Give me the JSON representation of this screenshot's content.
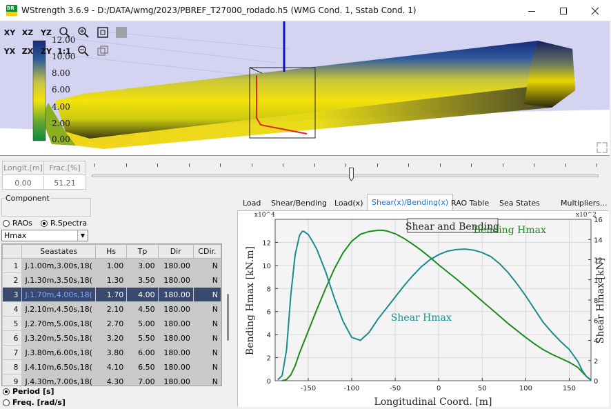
{
  "window": {
    "title": "WStrength 3.6.9 - D:/DATA/wmg/2023/PBREF_T27000_rodado.h5 (WMG Cond. 1, Sstab Cond. 1)",
    "logo_text": "BR",
    "logo_icon": "petrobras-logo-icon",
    "minimize_icon": "minimize-icon",
    "maximize_icon": "maximize-icon",
    "close_icon": "close-icon"
  },
  "view_toolbar": {
    "row1": [
      "XY",
      "XZ",
      "YZ"
    ],
    "row2": [
      "YX",
      "ZX",
      "ZY",
      "1:1"
    ],
    "icons": [
      "zoom-icon",
      "zoom-in-icon",
      "fit-view-icon",
      "color-square-icon",
      "zoom-out-icon",
      "perspective-icon"
    ]
  },
  "colorbar": {
    "labels": [
      "12.00",
      "10.00",
      "8.00",
      "6.00",
      "4.00",
      "2.00",
      "0.00"
    ],
    "colors_top_to_bottom": [
      "#1a2a7a",
      "#2a5a9a",
      "#c8c640",
      "#f5e20a",
      "#6aaa30",
      "#0a8a3a"
    ]
  },
  "position": {
    "headers": [
      "Longit.[m]",
      "Frac.[%]"
    ],
    "values": [
      "0.00",
      "51.21"
    ],
    "slider_fraction": 0.5121
  },
  "component": {
    "group_title": "Component",
    "radio_raos": "RAOs",
    "radio_spectra": "R.Spectra",
    "selected": "R.Spectra",
    "dropdown_value": "Hmax"
  },
  "seastates": {
    "headers": [
      "",
      "Seastates",
      "Hs",
      "Tp",
      "Dir",
      "CDir."
    ],
    "selected_row": 3,
    "rows": [
      {
        "n": "1",
        "name": "J.1.00m,3.00s,18(",
        "hs": "1.00",
        "tp": "3.00",
        "dir": "180.00",
        "cdir": "N"
      },
      {
        "n": "2",
        "name": "J.1.30m,3.50s,18(",
        "hs": "1.30",
        "tp": "3.50",
        "dir": "180.00",
        "cdir": "N"
      },
      {
        "n": "3",
        "name": "J.1.70m,4.00s,18(",
        "hs": "1.70",
        "tp": "4.00",
        "dir": "180.00",
        "cdir": "N"
      },
      {
        "n": "4",
        "name": "J.2.10m,4.50s,18(",
        "hs": "2.10",
        "tp": "4.50",
        "dir": "180.00",
        "cdir": "N"
      },
      {
        "n": "5",
        "name": "J.2.70m,5.00s,18(",
        "hs": "2.70",
        "tp": "5.00",
        "dir": "180.00",
        "cdir": "N"
      },
      {
        "n": "6",
        "name": "J.3.20m,5.50s,18(",
        "hs": "3.20",
        "tp": "5.50",
        "dir": "180.00",
        "cdir": "N"
      },
      {
        "n": "7",
        "name": "J.3.80m,6.00s,18(",
        "hs": "3.80",
        "tp": "6.00",
        "dir": "180.00",
        "cdir": "N"
      },
      {
        "n": "8",
        "name": "J.4.10m,6.50s,18(",
        "hs": "4.10",
        "tp": "6.50",
        "dir": "180.00",
        "cdir": "N"
      },
      {
        "n": "9",
        "name": "J.4.30m,7.00s,18(",
        "hs": "4.30",
        "tp": "7.00",
        "dir": "180.00",
        "cdir": "N"
      }
    ]
  },
  "axis_mode": {
    "period_label": "Period [s]",
    "freq_label": "Freq. [rad/s]",
    "selected": "Period [s]"
  },
  "tabs": {
    "items": [
      "Load",
      "Shear/Bending",
      "Load(x)",
      "Shear(x)/Bending(x)",
      "RAO Table",
      "Sea States",
      "Multipliers..."
    ],
    "active": "Shear(x)/Bending(x)"
  },
  "chart_data": {
    "type": "line",
    "title": "Shear and Bending",
    "xlabel": "Longitudinal Coord. [m]",
    "ylabel": "Bending Hmax [kN.m]",
    "y2label": "Shear Hmax [kN]",
    "xlim": [
      -188,
      175
    ],
    "ylim": [
      0,
      14
    ],
    "y2lim": [
      0,
      16
    ],
    "x_ticks": [
      -150,
      -100,
      -50,
      0,
      50,
      100,
      150
    ],
    "y_ticks": [
      0,
      2,
      4,
      6,
      8,
      10,
      12
    ],
    "y2_ticks": [
      0,
      2,
      4,
      6,
      8,
      10,
      12,
      14,
      16
    ],
    "y_multiplier": "x10^4",
    "y2_multiplier": "x10^2",
    "grid": true,
    "series": [
      {
        "name": "Bending Hmax",
        "axis": "left",
        "color": "#1a8a1a",
        "x": [
          -180,
          -175,
          -170,
          -165,
          -160,
          -150,
          -140,
          -130,
          -120,
          -110,
          -100,
          -90,
          -80,
          -70,
          -65,
          -60,
          -50,
          -40,
          -30,
          -20,
          -10,
          0,
          10,
          20,
          30,
          40,
          50,
          60,
          70,
          80,
          90,
          100,
          110,
          120,
          130,
          140,
          150,
          160,
          165,
          170,
          175
        ],
        "values": [
          0.0,
          0.1,
          0.5,
          1.3,
          2.4,
          4.3,
          6.2,
          8.0,
          9.7,
          11.1,
          12.1,
          12.7,
          12.95,
          13.05,
          13.05,
          13.0,
          12.75,
          12.35,
          11.85,
          11.3,
          10.7,
          10.05,
          9.45,
          8.85,
          8.2,
          7.55,
          6.9,
          6.25,
          5.6,
          4.95,
          4.35,
          3.75,
          3.2,
          2.7,
          2.3,
          1.95,
          1.6,
          1.15,
          0.75,
          0.35,
          0.05
        ]
      },
      {
        "name": "Shear Hmax",
        "axis": "right",
        "color": "#1a8a8a",
        "x": [
          -185,
          -180,
          -175,
          -170,
          -165,
          -160,
          -157,
          -155,
          -150,
          -145,
          -140,
          -130,
          -120,
          -110,
          -100,
          -90,
          -80,
          -70,
          -60,
          -50,
          -40,
          -30,
          -20,
          -10,
          0,
          10,
          20,
          30,
          40,
          50,
          60,
          70,
          80,
          90,
          100,
          110,
          120,
          130,
          140,
          150,
          160,
          165,
          170,
          175
        ],
        "values": [
          0.1,
          0.5,
          3.0,
          8.5,
          12.5,
          14.4,
          14.8,
          14.8,
          14.5,
          13.8,
          13.0,
          10.8,
          8.2,
          5.9,
          4.3,
          4.0,
          4.8,
          6.1,
          7.2,
          8.3,
          9.4,
          10.4,
          11.3,
          12.0,
          12.5,
          12.85,
          13.0,
          13.05,
          12.95,
          12.7,
          12.3,
          11.6,
          10.7,
          9.6,
          8.4,
          7.1,
          5.8,
          4.8,
          3.9,
          3.1,
          1.9,
          1.0,
          0.4,
          0.1
        ]
      }
    ],
    "annotations": [
      {
        "text": "Bending Hmax",
        "x": 40,
        "y": 12.8
      },
      {
        "text": "Shear Hmax",
        "x": -55,
        "y": 5.2
      }
    ]
  }
}
